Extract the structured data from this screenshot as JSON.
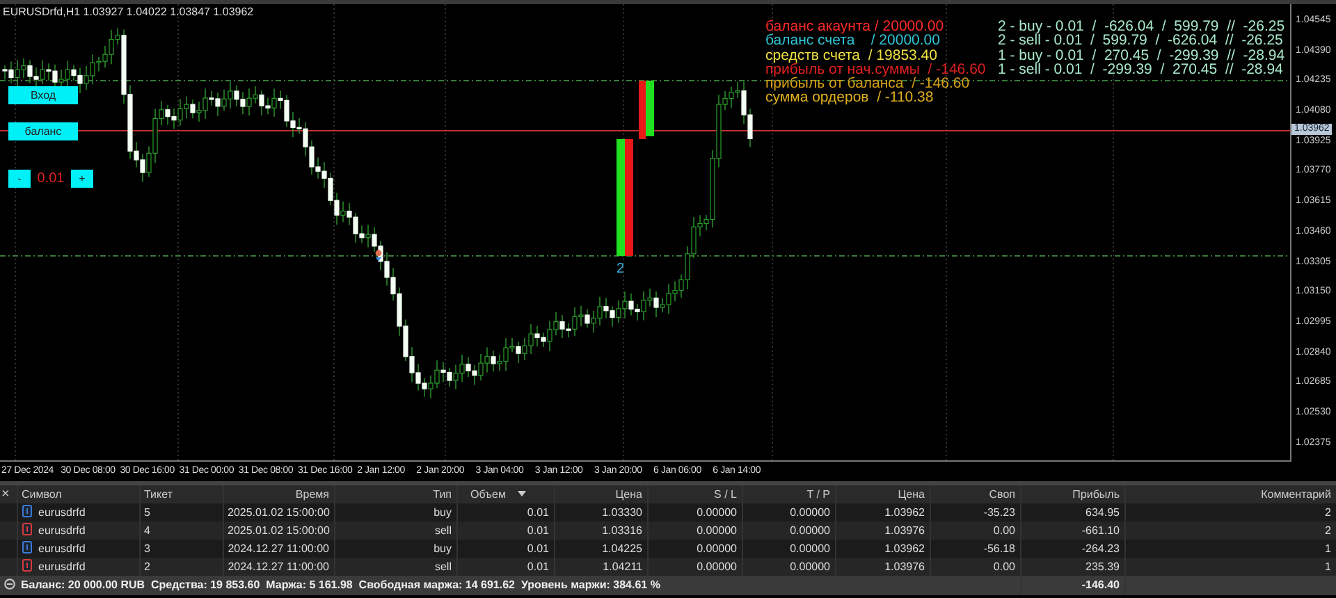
{
  "chart": {
    "title": "EURUSDrfd,H1  1.03927 1.04022 1.03847 1.03962",
    "buttons": [
      {
        "label": "Вход"
      },
      {
        "label": "баланс"
      }
    ],
    "lot_control": {
      "minus": "-",
      "value": "0.01",
      "plus": "+"
    },
    "account_lines": [
      {
        "text": "баланс акаунта / 20000.00",
        "color": "#ff2a2a"
      },
      {
        "text": "баланс счета    / 20000.00",
        "color": "#2ec4d6"
      },
      {
        "text": "средств счета  / 19853.40",
        "color": "#f0e040"
      },
      {
        "text": "прибыль от нач.суммы  / -146.60",
        "color": "#e02020"
      },
      {
        "text": "прибыль от баланса  / -146.60",
        "color": "#d4a017"
      },
      {
        "text": "сумма ордеров  / -110.38",
        "color": "#e0b020"
      }
    ],
    "order_lines": [
      "2 - buy - 0.01  /  -626.04  /  599.79  //  -26.25",
      "2 - sell - 0.01  /  599.79  /  -626.04  //  -26.25",
      "1 - buy - 0.01  /  270.45  /  -299.39  //  -28.94",
      "1 - sell - 0.01  /  -299.39  /  270.45  //  -28.94"
    ],
    "marker_label": "2",
    "price_ticks": [
      "1.04545",
      "1.04390",
      "1.04235",
      "1.04080",
      "1.03925",
      "1.03770",
      "1.03615",
      "1.03460",
      "1.03305",
      "1.03150",
      "1.02995",
      "1.02840",
      "1.02685",
      "1.02530",
      "1.02375"
    ],
    "current_price": "1.03962",
    "time_ticks": [
      "27 Dec 2024",
      "30 Dec 08:00",
      "30 Dec 16:00",
      "31 Dec 00:00",
      "31 Dec 08:00",
      "31 Dec 16:00",
      "2 Jan 12:00",
      "2 Jan 20:00",
      "3 Jan 04:00",
      "3 Jan 12:00",
      "3 Jan 20:00",
      "6 Jan 06:00",
      "6 Jan 14:00"
    ]
  },
  "positions": {
    "close": "×",
    "columns": [
      {
        "label": "Символ",
        "sorted": false
      },
      {
        "label": "Тикет",
        "sorted": false
      },
      {
        "label": "Время",
        "sorted": false
      },
      {
        "label": "Тип",
        "sorted": false
      },
      {
        "label": "Объем",
        "sorted": true
      },
      {
        "label": "Цена",
        "sorted": false
      },
      {
        "label": "S / L",
        "sorted": false
      },
      {
        "label": "T / P",
        "sorted": false
      },
      {
        "label": "Цена",
        "sorted": false
      },
      {
        "label": "Своп",
        "sorted": false
      },
      {
        "label": "Прибыль",
        "sorted": false
      },
      {
        "label": "Комментарий",
        "sorted": false
      }
    ],
    "rows": [
      {
        "kind": "buy",
        "cells": [
          "eurusdrfd",
          "5",
          "2025.01.02 15:00:00",
          "buy",
          "0.01",
          "1.03330",
          "0.00000",
          "0.00000",
          "1.03962",
          "-35.23",
          "634.95",
          "2"
        ]
      },
      {
        "kind": "sell",
        "cells": [
          "eurusdrfd",
          "4",
          "2025.01.02 15:00:00",
          "sell",
          "0.01",
          "1.03316",
          "0.00000",
          "0.00000",
          "1.03976",
          "0.00",
          "-661.10",
          "2"
        ]
      },
      {
        "kind": "buy",
        "cells": [
          "eurusdrfd",
          "3",
          "2024.12.27 11:00:00",
          "buy",
          "0.01",
          "1.04225",
          "0.00000",
          "0.00000",
          "1.03962",
          "-56.18",
          "-264.23",
          "1"
        ]
      },
      {
        "kind": "sell",
        "cells": [
          "eurusdrfd",
          "2",
          "2024.12.27 11:00:00",
          "sell",
          "0.01",
          "1.04211",
          "0.00000",
          "0.00000",
          "1.03976",
          "0.00",
          "235.39",
          "1"
        ]
      }
    ],
    "summary": {
      "text": "Баланс: 20 000.00 RUB  Средства: 19 853.60  Маржа: 5 161.98  Свободная маржа: 14 691.62  Уровень маржи: 384.61 %",
      "profit": "-146.40"
    }
  }
}
